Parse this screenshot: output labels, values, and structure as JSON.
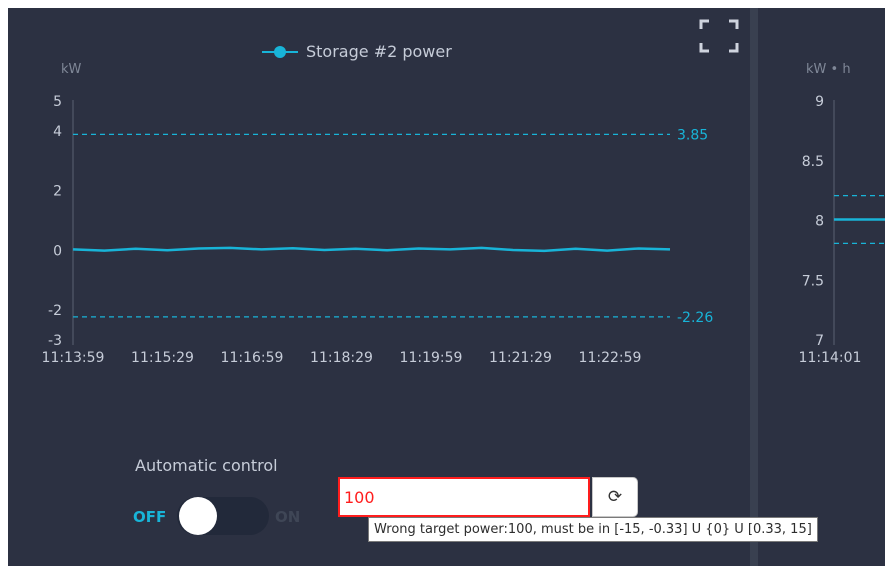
{
  "left_chart": {
    "legend": "Storage #2 power",
    "unit_label": "kW",
    "expand_icon": "fullscreen-icon",
    "y_ticks": [
      "5",
      "4",
      "2",
      "0",
      "-2",
      "-3"
    ],
    "x_ticks": [
      "11:13:59",
      "11:15:29",
      "11:16:59",
      "11:18:29",
      "11:19:59",
      "11:21:29",
      "11:22:59"
    ],
    "upper_limit_label": "3.85",
    "lower_limit_label": "-2.26"
  },
  "right_chart": {
    "unit_label": "kW • h",
    "y_ticks": [
      "9",
      "8.5",
      "8",
      "7.5",
      "7"
    ],
    "x_ticks": [
      "11:14:01"
    ]
  },
  "control": {
    "automatic_label": "Automatic control",
    "off_label": "OFF",
    "on_label": "ON",
    "auto_enabled": false,
    "target_power_value": "100",
    "tooltip": "Wrong target power:100, must be in [-15, -0.33] U {0} U [0.33, 15]"
  },
  "colors": {
    "background": "#2c3142",
    "series": "#18b4d8",
    "axis_text": "#c6ccd8",
    "error": "#ff1d1d"
  },
  "chart_data": [
    {
      "type": "line",
      "title": "",
      "ylabel": "kW",
      "ylim": [
        -3,
        5
      ],
      "legend_position": "top-center",
      "x": [
        "11:13:59",
        "11:14:29",
        "11:14:59",
        "11:15:29",
        "11:15:59",
        "11:16:29",
        "11:16:59",
        "11:17:29",
        "11:17:59",
        "11:18:29",
        "11:18:59",
        "11:19:29",
        "11:19:59",
        "11:20:29",
        "11:20:59",
        "11:21:29",
        "11:21:59",
        "11:22:29",
        "11:22:59",
        "11:23:29"
      ],
      "series": [
        {
          "name": "Storage #2 power",
          "values": [
            0.0,
            -0.04,
            0.02,
            -0.03,
            0.03,
            0.05,
            0.0,
            0.04,
            -0.02,
            0.02,
            -0.03,
            0.03,
            0.0,
            0.05,
            -0.02,
            -0.05,
            0.02,
            -0.04,
            0.03,
            0.0
          ]
        }
      ],
      "reference_lines": [
        {
          "label": "3.85",
          "value": 3.85,
          "style": "dashed"
        },
        {
          "label": "-2.26",
          "value": -2.26,
          "style": "dashed"
        }
      ]
    },
    {
      "type": "line",
      "title": "",
      "ylabel": "kW • h",
      "ylim": [
        7,
        9
      ],
      "x": [
        "11:14:01"
      ],
      "series": [
        {
          "values": [
            8.0
          ]
        }
      ],
      "reference_lines": [
        {
          "value": 8.2,
          "style": "dashed"
        },
        {
          "value": 7.8,
          "style": "dashed"
        }
      ]
    }
  ]
}
